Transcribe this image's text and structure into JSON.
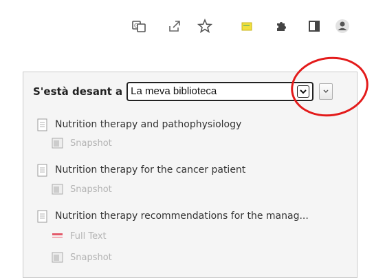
{
  "toolbar": {
    "icons": [
      "translate-icon",
      "share-icon",
      "bookmark-star-icon",
      "zotero-icon",
      "extensions-puzzle-icon",
      "side-panel-icon",
      "profile-avatar-icon"
    ]
  },
  "popup": {
    "saving_label": "S'està desant a",
    "library_select": {
      "selected": "La meva biblioteca"
    },
    "items": [
      {
        "title": "Nutrition therapy and pathophysiology",
        "attachments": [
          "Snapshot"
        ]
      },
      {
        "title": "Nutrition therapy for the cancer patient",
        "attachments": [
          "Snapshot"
        ]
      },
      {
        "title": "Nutrition therapy recommendations for the manag...",
        "attachments": [
          "Full Text",
          "Snapshot"
        ]
      }
    ]
  },
  "colors": {
    "highlight": "#e31b1b",
    "popup_bg": "#f5f5f5",
    "zotero_icon": "#f2e03c"
  }
}
